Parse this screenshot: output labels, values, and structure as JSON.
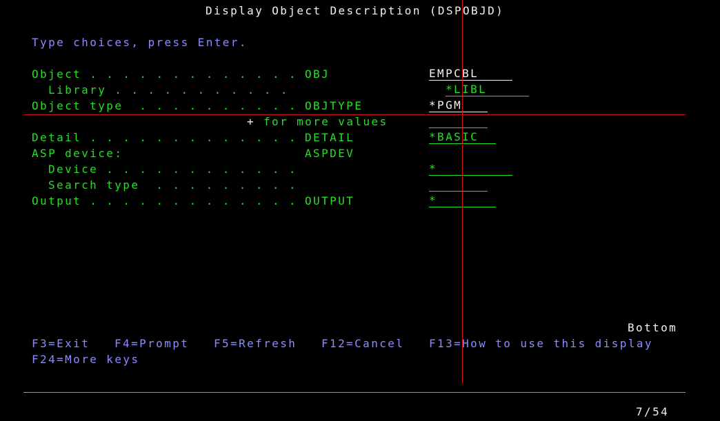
{
  "screen": {
    "title": "Display Object Description (DSPOBJD)",
    "instruction": "Type choices, press Enter."
  },
  "prompts": {
    "object": {
      "label": "Object . . . . . . . . . . . . .",
      "keyword": "OBJ",
      "value": "EMPCBL"
    },
    "library": {
      "label": "Library . . . . . . . . . . .",
      "value": "*LIBL"
    },
    "object_type": {
      "label": "Object type  . . . . . . . . . .",
      "keyword": "OBJTYPE",
      "value": "*PGM"
    },
    "more_values": {
      "plus": "+",
      "text": "for more values",
      "value": ""
    },
    "detail": {
      "label": "Detail . . . . . . . . . . . . .",
      "keyword": "DETAIL",
      "value": "*BASIC"
    },
    "asp_device": {
      "label": "ASP device:",
      "keyword": "ASPDEV"
    },
    "device": {
      "label": "Device . . . . . . . . . . . .",
      "value": "*"
    },
    "search_type": {
      "label": "Search type  . . . . . . . . .",
      "value": ""
    },
    "output": {
      "label": "Output . . . . . . . . . . . . .",
      "keyword": "OUTPUT",
      "value": "*"
    }
  },
  "footer": {
    "position": "Bottom",
    "keys_row1": [
      "F3=Exit",
      "F4=Prompt",
      "F5=Refresh",
      "F12=Cancel",
      "F13=How to use this display"
    ],
    "keys_row2": [
      "F24=More keys"
    ]
  },
  "status": {
    "cursor": "7/54"
  },
  "colors": {
    "background": "#000000",
    "field_text": "#24e024",
    "instruction_text": "#8c8cff",
    "title_text": "#f2f2f2",
    "crosshair": "#d01010"
  }
}
